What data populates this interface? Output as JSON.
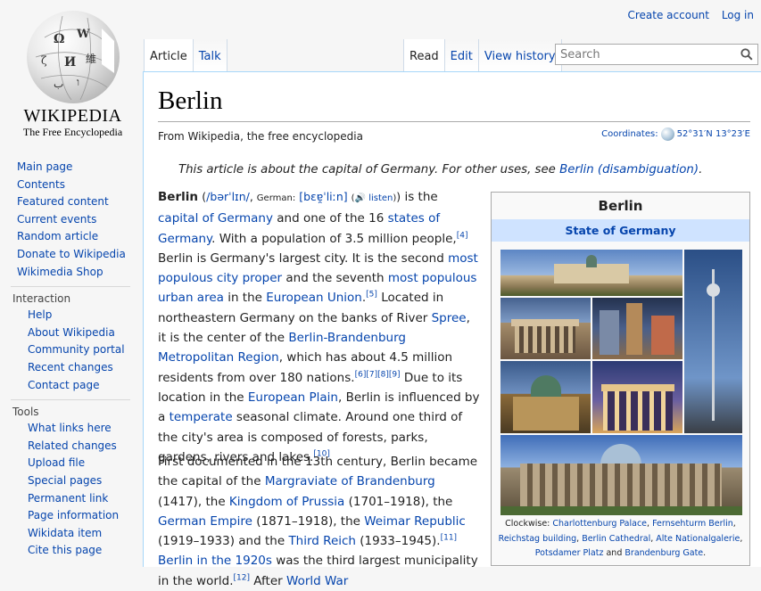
{
  "personal": {
    "create_account": "Create account",
    "login": "Log in"
  },
  "logo": {
    "wordmark": "WIKIPEDIA",
    "tagline": "The Free Encyclopedia"
  },
  "nav": {
    "main": [
      "Main page",
      "Contents",
      "Featured content",
      "Current events",
      "Random article",
      "Donate to Wikipedia",
      "Wikimedia Shop"
    ],
    "interaction": {
      "heading": "Interaction",
      "items": [
        "Help",
        "About Wikipedia",
        "Community portal",
        "Recent changes",
        "Contact page"
      ]
    },
    "tools": {
      "heading": "Tools",
      "items": [
        "What links here",
        "Related changes",
        "Upload file",
        "Special pages",
        "Permanent link",
        "Page information",
        "Wikidata item",
        "Cite this page"
      ]
    }
  },
  "tabs": {
    "article": "Article",
    "talk": "Talk",
    "read": "Read",
    "edit": "Edit",
    "history": "View history"
  },
  "search": {
    "placeholder": "Search"
  },
  "article": {
    "title": "Berlin",
    "from": "From Wikipedia, the free encyclopedia",
    "coords_label": "Coordinates:",
    "coords_value": "52°31′N 13°23′E",
    "hatnote_text": "This article is about the capital of Germany. For other uses, see ",
    "hatnote_link": "Berlin (disambiguation)",
    "hatnote_end": "."
  },
  "infobox": {
    "title": "Berlin",
    "subtitle": "State of Germany",
    "caption_lead": "Clockwise: ",
    "caption_links": [
      "Charlottenburg Palace",
      "Fernsehturm Berlin",
      "Reichstag building",
      "Berlin Cathedral",
      "Alte Nationalgalerie",
      "Potsdamer Platz",
      "Brandenburg Gate"
    ],
    "caption_and": "and"
  },
  "colors": {
    "link": "#0645ad",
    "infobox_header": "#cfe3ff",
    "border": "#a7d7f9"
  }
}
